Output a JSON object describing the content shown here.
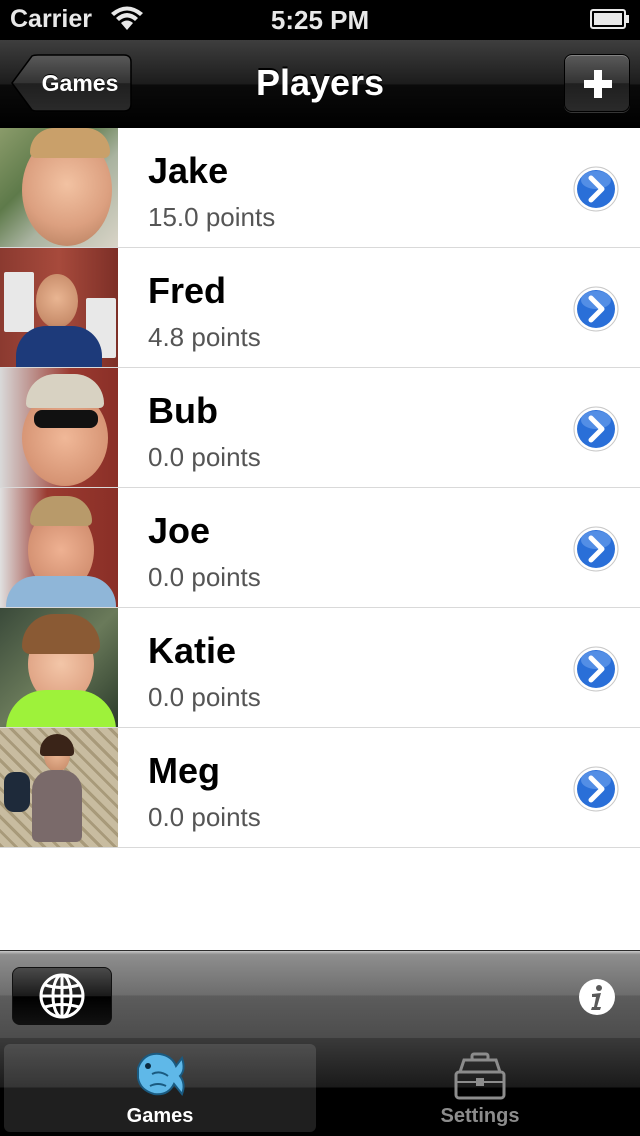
{
  "status_bar": {
    "carrier": "Carrier",
    "time": "5:25 PM"
  },
  "nav_bar": {
    "back_label": "Games",
    "title": "Players",
    "add_icon": "plus-icon"
  },
  "players": [
    {
      "name": "Jake",
      "points": "15.0  points"
    },
    {
      "name": "Fred",
      "points": "4.8  points"
    },
    {
      "name": "Bub",
      "points": "0.0  points"
    },
    {
      "name": "Joe",
      "points": "0.0  points"
    },
    {
      "name": "Katie",
      "points": "0.0  points"
    },
    {
      "name": "Meg",
      "points": "0.0  points"
    }
  ],
  "toolbar": {
    "left_icon": "globe-icon",
    "right_icon": "info-icon"
  },
  "tab_bar": {
    "tabs": [
      {
        "label": "Games",
        "icon": "fish-icon",
        "selected": true
      },
      {
        "label": "Settings",
        "icon": "tackle-box-icon",
        "selected": false
      }
    ]
  },
  "colors": {
    "disclosure_blue": "#2a6fd8",
    "points_gray": "#555555"
  }
}
